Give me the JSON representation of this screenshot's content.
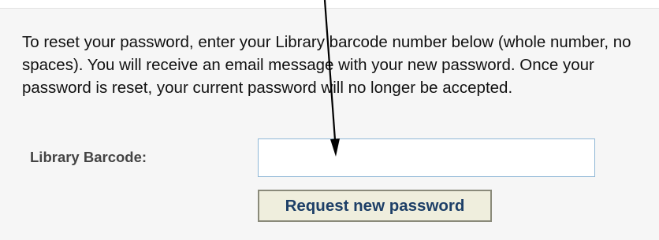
{
  "form": {
    "instructions": "To reset your password, enter your Library barcode number below (whole number, no spaces). You will receive an email message with your new password. Once your password is reset, your current password will no longer be accepted.",
    "barcode_label": "Library Barcode:",
    "barcode_value": "",
    "submit_label": "Request new password"
  },
  "annotation": {
    "icon": "down-arrow-icon",
    "color": "#000000"
  },
  "colors": {
    "panel_background": "#f6f6f6",
    "button_background": "#efeedd",
    "button_text": "#1d3f67",
    "input_border": "#8fb7d6"
  }
}
